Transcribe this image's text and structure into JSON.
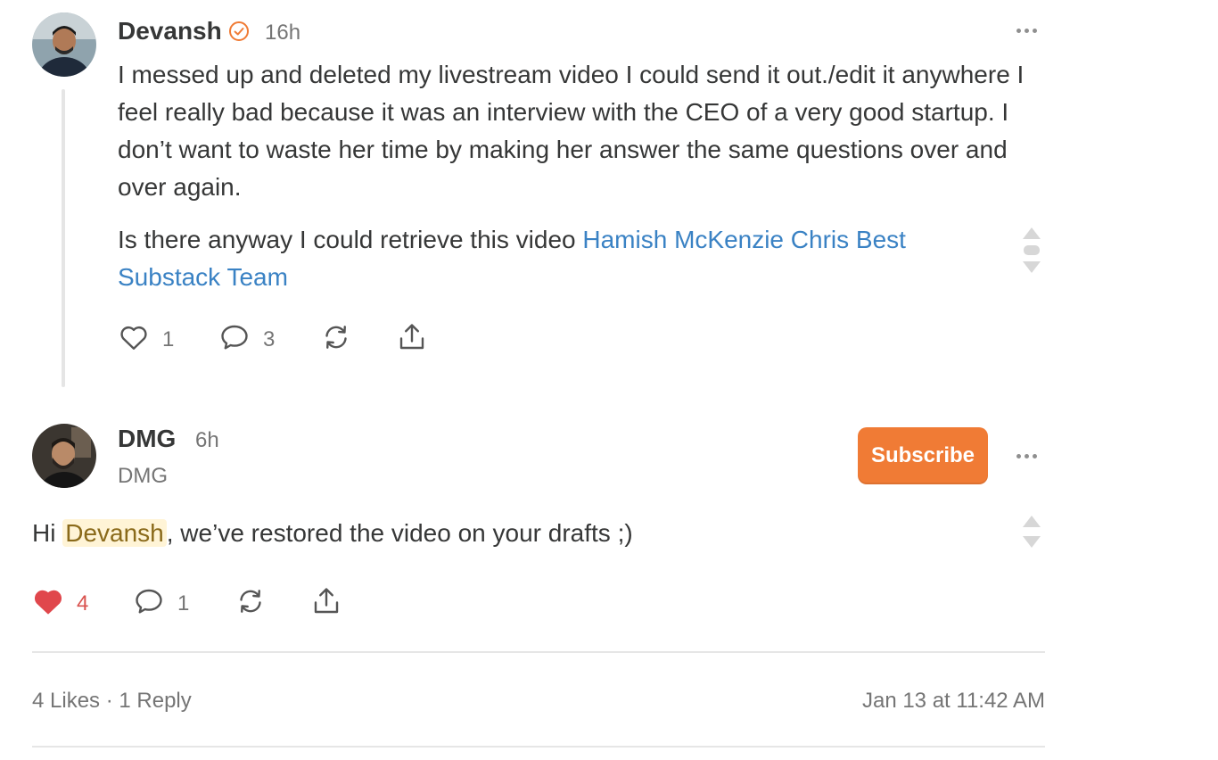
{
  "comment": {
    "author": "Devansh",
    "time": "16h",
    "paragraph1": "I messed up and deleted my livestream video I could send it out./edit it anywhere I feel really bad because it was an interview with the CEO of a very good startup. I don’t want to waste her time by making her answer the same questions over and over again.",
    "paragraph2_text": "Is there anyway I could retrieve this video ",
    "mentions": [
      "Hamish McKenzie",
      "Chris Best",
      "Substack Team"
    ],
    "likes": "1",
    "replies": "3",
    "icons": {
      "verified": "check-circle-icon",
      "like": "heart-outline-icon",
      "comment": "speech-bubble-icon",
      "restack": "restack-icon",
      "share": "share-icon",
      "more": "more-horizontal-icon"
    }
  },
  "reply": {
    "author": "DMG",
    "time": "6h",
    "publication": "DMG",
    "subscribe_label": "Subscribe",
    "text_before": "Hi ",
    "mention": "Devansh",
    "text_after": ", we’ve restored the video on your drafts ;)",
    "likes": "4",
    "replies": "1",
    "icons": {
      "like": "heart-filled-icon",
      "comment": "speech-bubble-icon",
      "restack": "restack-icon",
      "share": "share-icon",
      "more": "more-horizontal-icon"
    }
  },
  "footer": {
    "likes": "4 Likes",
    "separator": "·",
    "replies": "1 Reply",
    "timestamp": "Jan 13 at 11:42 AM"
  },
  "colors": {
    "accent": "#f07b35",
    "link": "#3a82c4",
    "liked": "#e0474c",
    "mention_bg": "#fff4d6"
  }
}
